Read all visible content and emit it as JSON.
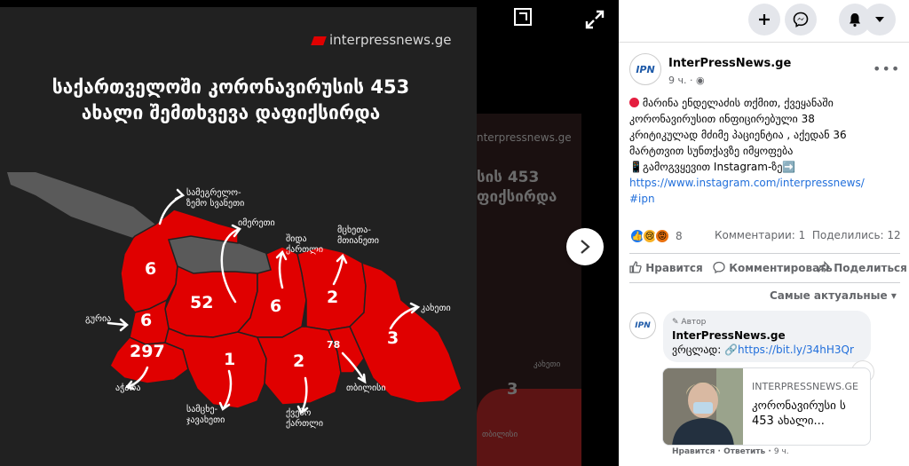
{
  "viewer": {
    "brand": "interpressnews.ge",
    "headline_line1": "საქართველოში კორონავირუსის 453",
    "headline_line2": "ახალი შემთხვევა დაფიქსირდა",
    "regions": [
      {
        "label": "სამეგრელო-ზემო სვანეთი",
        "value": "6"
      },
      {
        "label": "იმერეთი",
        "value": "52"
      },
      {
        "label": "შიდა ქართლი",
        "value": "6"
      },
      {
        "label": "მცხეთა-მთიანეთი",
        "value": "2"
      },
      {
        "label": "კახეთი",
        "value": "3"
      },
      {
        "label": "გურია",
        "value": "6"
      },
      {
        "label": "აჭარა",
        "value": "297"
      },
      {
        "label": "სამცხე-ჯავახეთი",
        "value": "1"
      },
      {
        "label": "ქვემო ქართლი",
        "value": "2"
      },
      {
        "label": "თბილისი",
        "value": "78"
      }
    ],
    "region_labels": {
      "samegrelo_1": "სამეგრელო-",
      "samegrelo_2": "ზემო სვანეთი",
      "imereti": "იმერეთი",
      "shida_1": "შიდა",
      "shida_2": "ქართლი",
      "mtskheta_1": "მცხეთა-",
      "mtskheta_2": "მთიანეთი",
      "kakheti": "კახეთი",
      "guria": "გურია",
      "adjara": "აჭარა",
      "samtskhe_1": "სამცხე-",
      "samtskhe_2": "ჯავახეთი",
      "kvemo_1": "ქვემო",
      "kvemo_2": "ქართლი",
      "tbilisi": "თბილისი"
    },
    "bg_ghost": {
      "domain": "nterpressnews.ge",
      "title_1": "სის 453",
      "title_2": "ფიქსირდა",
      "num": "3",
      "label": "კახეთი",
      "label2": "თბილისი"
    },
    "colors": {
      "map_red": "#e00000",
      "map_grey": "#5a5a5a",
      "card_bg": "#212121"
    }
  },
  "post": {
    "page_name": "InterPressNews.ge",
    "time": "9 ч.",
    "time_sep": "·",
    "text_line1": " მარინა ენდელაძის თქმით, ქვეყანაში",
    "text_line2": "კორონავირუსით ინფიცირებული 38",
    "text_line3": "კრიტიკულად მძიმე პაციენტია , აქედან 36",
    "text_line4": "მარტთვით სუნთქავზე იმყოფება",
    "text_line5": "📱გამოგვყევით Instagram-ზე➡️",
    "link": "https://www.instagram.com/interpressnews/",
    "hashtag": "#ipn",
    "reaction_count": "8",
    "comments": "Комментарии: 1",
    "shares": "Поделились: 12",
    "like_label": "Нравится",
    "comment_label": "Комментировать",
    "share_label": "Поделиться",
    "sort_label": "Самые актуальные",
    "logo_text": "IPN"
  },
  "comment": {
    "badge": "Автор",
    "author": "InterPressNews.ge",
    "text_prefix": "ვრცლად: 🔗",
    "link": "https://bit.ly/34hH3Qr",
    "info": "i",
    "card_domain": "INTERPRESSNEWS.GE",
    "card_title": "კორონავირუსი ს 453 ახალი...",
    "like": "Нравится",
    "reply": "Ответить",
    "time": "9 ч.",
    "sep": " · "
  }
}
